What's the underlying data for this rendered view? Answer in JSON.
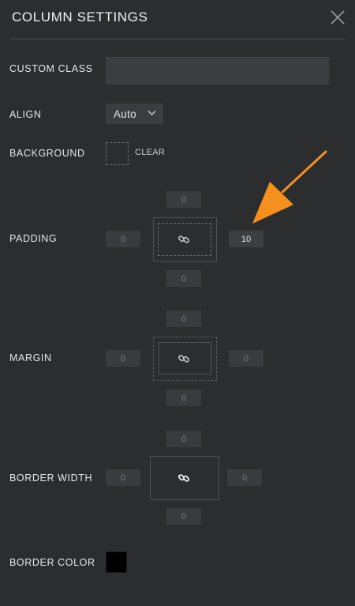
{
  "panel": {
    "title": "COLUMN SETTINGS"
  },
  "fields": {
    "custom_class": {
      "label": "CUSTOM CLASS",
      "value": ""
    },
    "align": {
      "label": "ALIGN",
      "value": "Auto"
    },
    "background": {
      "label": "BACKGROUND",
      "clear_label": "CLEAR"
    },
    "padding": {
      "label": "PADDING",
      "top": "0",
      "left": "0",
      "right": "10",
      "bottom": "0"
    },
    "margin": {
      "label": "MARGIN",
      "top": "0",
      "left": "0",
      "right": "0",
      "bottom": "0"
    },
    "border_width": {
      "label": "BORDER WIDTH",
      "top": "0",
      "left": "0",
      "right": "0",
      "bottom": "0"
    },
    "border_color": {
      "label": "BORDER COLOR",
      "value": "#000000"
    }
  },
  "icons": {
    "close": "close-icon",
    "chevron": "chevron-down-icon",
    "link": "link-icon",
    "annotation_arrow": "arrow-icon"
  },
  "colors": {
    "background": "#2c2d2f",
    "field": "#3c3d40",
    "annotation": "#f5901e"
  }
}
